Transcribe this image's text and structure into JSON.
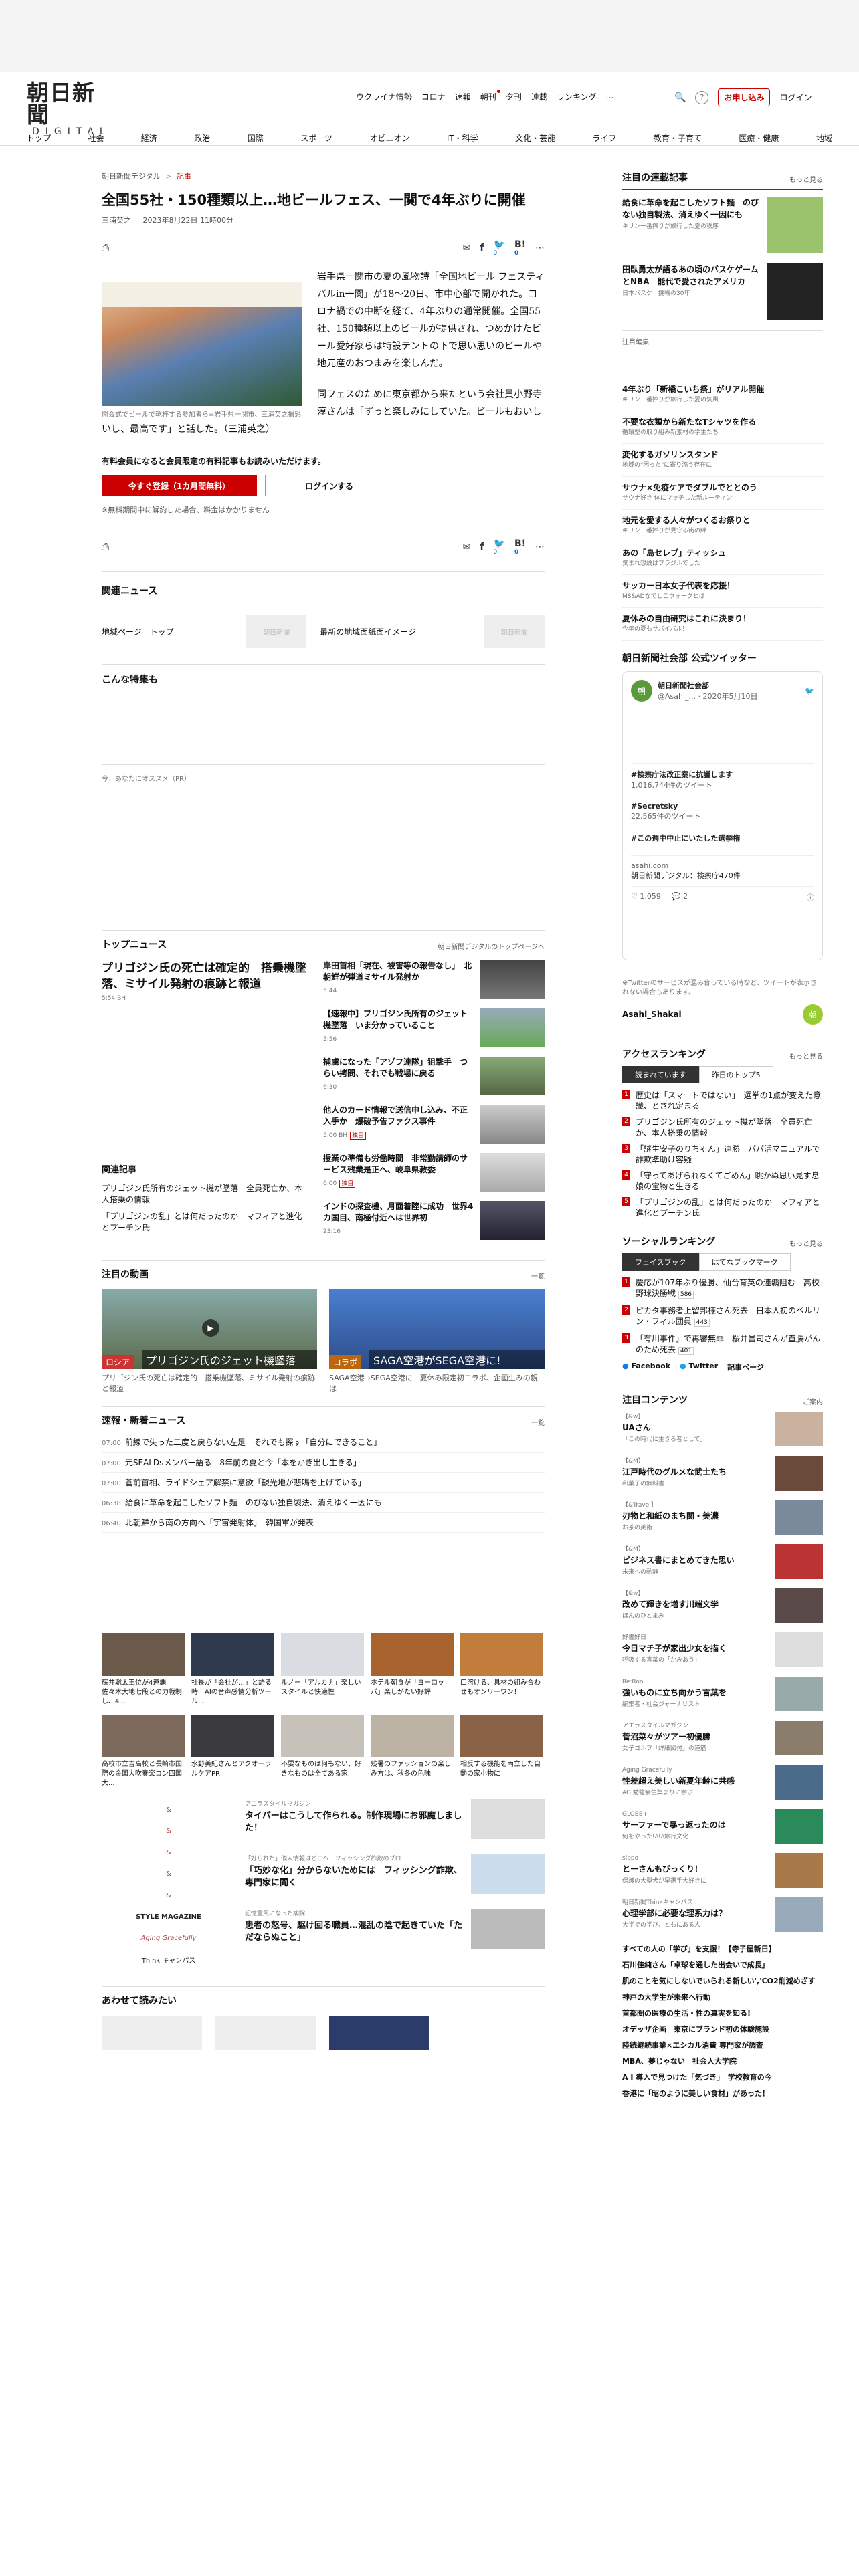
{
  "header": {
    "logo_jp": "朝日新聞",
    "logo_en": "DIGITAL",
    "gnav": [
      "ウクライナ情勢",
      "コロナ",
      "速報",
      "朝刊",
      "夕刊",
      "連載",
      "ランキング",
      "…"
    ],
    "subscribe": "お申し込み",
    "login": "ログイン",
    "categories": [
      "トップ",
      "社会",
      "経済",
      "政治",
      "国際",
      "スポーツ",
      "オピニオン",
      "IT・科学",
      "文化・芸能",
      "ライフ",
      "教育・子育て",
      "医療・健康",
      "地域"
    ]
  },
  "article": {
    "crumb_site": "朝日新聞デジタル",
    "crumb_sep": ">",
    "crumb_cat": "記事",
    "title": "全国55社・150種類以上…地ビールフェス、一関で4年ぶりに開催",
    "author": "三浦英之",
    "date": "2023年8月22日 11時00分",
    "share_count": "0",
    "photo_caption": "開会式でビールで乾杯する参加者ら=岩手県一関市、三浦英之撮影",
    "p1": "岩手県一関市の夏の風物詩「全国地ビール フェスティバルin一関」が18〜20日、市中心部で開かれた。コロナ禍での中断を経て、4年ぶりの通常開催。全国55社、150種類以上のビールが提供され、つめかけたビール愛好家らは特設テントの下で思い思いのビールや地元産のおつまみを楽しんだ。",
    "p2": "同フェスのために東京都から来たという会社員小野寺淳さんは「ずっと楽しみにしていた。ビールもおいしいし、最高です」と話した。（三浦英之）",
    "paid_note": "有料会員になると会員限定の有料記事もお読みいただけます。",
    "register_btn": "今すぐ登録（1カ月間無料）",
    "login_btn": "ログインする",
    "cancel_note": "※無料期間中に解約した場合、料金はかかりません"
  },
  "related": {
    "title": "関連ニュース",
    "item1": "地域ページ　トップ",
    "item2": "最新の地域面紙面イメージ",
    "ph": "朝日新聞"
  },
  "special": {
    "title": "こんな特集も"
  },
  "recommend": {
    "title": "今、あなたにオススメ（PR）"
  },
  "topnews": {
    "title": "トップニュース",
    "more": "朝日新聞デジタルのトップページへ",
    "lead": "プリゴジン氏の死亡は確定的　搭乗機墜落、ミサイル発射の痕跡と報道",
    "lead_time": "5:54 BH",
    "related_title": "関連記事",
    "related": [
      "プリゴジン氏所有のジェット機が墜落　全員死亡か、本人搭乗の情報",
      "「プリゴジンの乱」とは何だったのか　マフィアと進化とプーチン氏"
    ],
    "items": [
      {
        "title": "岸田首相「現在、被害等の報告なし」　北朝鮮が弾道ミサイル発射か",
        "time": "5:44"
      },
      {
        "title": "【速報中】プリゴジン氏所有のジェット機墜落　いま分かっていること",
        "time": "5:56"
      },
      {
        "title": "捕虜になった「アゾフ連隊」狙撃手　つらい拷問、それでも戦場に戻る",
        "time": "6:30"
      },
      {
        "title": "他人のカード情報で送信申し込み、不正入手か　爆破予告ファクス事件",
        "time": "5:00 BH",
        "excl": "独自"
      },
      {
        "title": "授業の準備も労働時間　非常勤講師のサービス残業是正へ、岐阜県教委",
        "time": "6:00",
        "excl": "独自"
      },
      {
        "title": "インドの探査機、月面着陸に成功　世界4カ国目、南極付近へは世界初",
        "time": "23:16"
      }
    ]
  },
  "videos": {
    "title": "注目の動画",
    "more": "一覧",
    "v1": {
      "tag": "ロシア",
      "overlay": "プリゴジン氏のジェット機墜落",
      "title": "プリゴジン氏の死亡は確定的　搭乗機墜落、ミサイル発射の痕跡と報道"
    },
    "v2": {
      "tag": "コラボ",
      "overlay": "SAGA空港がSEGA空港に!",
      "title": "SAGA空港→SEGA空港に　夏休み限定初コラボ、企画生みの親は"
    }
  },
  "flash": {
    "title": "速報・新着ニュース",
    "more": "一覧",
    "items": [
      {
        "time": "07:00",
        "text": "前線で失った二度と戻らない左足　それでも探す「自分にできること」"
      },
      {
        "time": "07:00",
        "text": "元SEALDsメンバー語る　8年前の夏と今「本をかき出し生きる」"
      },
      {
        "time": "07:00",
        "text": "菅前首相、ライドシェア解禁に意欲「観光地が悲鳴を上げている」"
      },
      {
        "time": "06:38",
        "text": "給食に革命を起こしたソフト麺　のびない独自製法、消えゆく一因にも"
      },
      {
        "time": "06:40",
        "text": "北朝鮮から南の方向へ「宇宙発射体」　韓国軍が発表"
      }
    ]
  },
  "grid": [
    "藤井聡太王位が4連覇　佐々木大地七段との力戦制し、4...",
    "社長が「会社が…」と語る時　AIの音声感情分析ツール…",
    "ルノー「アルカナ」楽しいスタイルと快適性",
    "ホテル朝食が「ヨーロッパ」楽しがたい好評",
    "口溶ける、具材の組み合わせもオンリーワン！",
    "高校市立吉高校と長崎市国際の金国大吹奏楽コン四国大...",
    "水野美紀さんとアクオーラルケアPR",
    "不要なものは何もない、好きなものは全てある家",
    "残暑のファッションの楽しみ方は、秋冬の色味",
    "相反する機能を両立した自動の家小物に"
  ],
  "ad_list": [
    {
      "kicker": "アエラスタイルマガジン",
      "title": "タイパーはこうして作られる。制作現場にお邪魔しました！"
    },
    {
      "kicker": "「好られた」個人情報はどこへ　フィッシング詐欺のプロ",
      "title": "「巧妙な化」分からないためには　フィッシング詐欺、専門家に聞く"
    },
    {
      "kicker": "記憶重風になった病院",
      "title": "患者の怒号、駆け回る職員…混乱の陰で起きていた「ただならぬこと」"
    }
  ],
  "brand_names": [
    "STYLE MAGAZINE",
    "Aging Gracefully",
    "Think キャンパス"
  ],
  "bottom": {
    "title": "あわせて読みたい"
  },
  "side": {
    "rensai_title": "注目の連載記事",
    "rensai_more": "もっと見る",
    "rensai": [
      {
        "title": "給食に革命を起こしたソフト麺　のびない独自製法、消えゆく一因にも",
        "sub": "キリン一番搾りが旅行した夏の秩序"
      },
      {
        "title": "田臥勇太が語るあの頃のバスケゲームとNBA　能代で愛されたアメリカ",
        "sub": "日本バスケ　挑戦の30年"
      }
    ],
    "feature_label": "注目編集",
    "feature": [
      {
        "title": "4年ぶり「新橋こいち祭」がリアル開催",
        "sub": "キリン一番搾りが旅行した夏の気風"
      },
      {
        "title": "不要な衣類から新たなTシャツを作る",
        "sub": "循環型の取り組み新素材の学生たち"
      },
      {
        "title": "変化するガソリンスタンド",
        "sub": "地域の\"困った\"に寄り添う存在に"
      },
      {
        "title": "サウナ×免疫ケアでダブルでととのう",
        "sub": "サウナ好き 体にマッチした新ルーティン"
      },
      {
        "title": "地元を愛する人々がつくるお祭りと",
        "sub": "キリン一番搾りが見守る街の絆"
      },
      {
        "title": "あの「島セレブ」ティッシュ",
        "sub": "気まれ想論はブラジルでした"
      },
      {
        "title": "サッカー日本女子代表を応援！",
        "sub": "MS&ADなでしこウォークとは"
      },
      {
        "title": "夏休みの自由研究はこれに決まり！",
        "sub": "今年の夏もサバイバル！"
      }
    ],
    "twitter_title": "朝日新聞社会部 公式ツイッター",
    "tw": {
      "name": "朝日新聞社会部",
      "handle": "@Asahi_...",
      "date": "2020年5月10日",
      "t1": "#検察庁法改正案に抗議します",
      "t1s": "1,016,744件のツイート",
      "t2": "#Secretsky",
      "t2s": "22,565件のツイート",
      "t3": "#この週中中止にいたした選挙権",
      "domain": "asahi.com",
      "d2": "朝日新聞デジタル：検察庁470件",
      "likes": "1,059",
      "rt": "2"
    },
    "tw_note": "※Twitterのサービスが混み合っている時など、ツイートが表示されない場合もあります。",
    "tw_account": "Asahi_Shakai",
    "ranking_title": "アクセスランキング",
    "ranking_more": "もっと見る",
    "rank_tabs": [
      "読まれています",
      "昨日のトップ5"
    ],
    "ranking": [
      "歴史は「スマートではない」　選挙の1点が変えた意識、とされ定まる",
      "プリゴジン氏所有のジェット機が墜落　全員死亡か、本人搭乗の情報",
      "「謎生安子のりちゃん」連勝　パパ活マニュアルで詐欺準助け容疑",
      "「守ってあげられなくてごめん」眺かぬ思い見す息　娘の宝物と生きる",
      "「プリゴジンの乱」とは何だったのか　マフィアと進化とプーチン氏"
    ],
    "social_title": "ソーシャルランキング",
    "social_more": "もっと見る",
    "social_tabs": [
      "フェイスブック",
      "はてなブックマーク"
    ],
    "social": [
      {
        "text": "慶応が107年ぶり優勝、仙台育英の連覇阻む　高校野球決勝戦",
        "c": "586"
      },
      {
        "text": "ピカタ事務者上留邦様さん死去　日本人初のベルリン・フィル団員",
        "c": "443"
      },
      {
        "text": "「有川事件」で再審無罪　桜井昌司さんが直腸がんのため死去",
        "c": "401"
      }
    ],
    "social_links": [
      "Facebook",
      "Twitter",
      "記事ページ"
    ],
    "content_title": "注目コンテンツ",
    "content_more": "ご案内",
    "contents": [
      {
        "k": "【&w】",
        "t": "UAさん",
        "s": "「この時代に生きる者として」"
      },
      {
        "k": "【&M】",
        "t": "江戸時代のグルメな武士たち",
        "s": "和菓子の無料書"
      },
      {
        "k": "【&Travel】",
        "t": "刃物と和紙のまち関・美濃",
        "s": "お茶の美術"
      },
      {
        "k": "【&M】",
        "t": "ビジネス書にまとめてきた思い",
        "s": "未来への動静"
      },
      {
        "k": "【&w】",
        "t": "改めて輝きを増す川端文学",
        "s": "ほんのひとまみ"
      },
      {
        "k": "好書好日",
        "t": "今日マチ子が家出少女を描く",
        "s": "呼吸する言葉の「かみあう」"
      },
      {
        "k": "Re:Ron",
        "t": "強いものに立ち向かう言葉を",
        "s": "編集者・社会ジャーナリスト"
      },
      {
        "k": "アエラスタイルマガジン",
        "t": "菅沼菜々がツアー初優勝",
        "s": "女子ゴルフ「詳細図付」の道筋"
      },
      {
        "k": "Aging Gracefully",
        "t": "性差超え美しい新夏年齢に共感",
        "s": "AG 勉強会生集まりに学ぶ"
      },
      {
        "k": "GLOBE+",
        "t": "サーファーで暴っ返ったのは",
        "s": "何をやったいい旅行文化"
      },
      {
        "k": "sippo",
        "t": "とーさんもびっくり！",
        "s": "保護の大型犬が早選手大好きに"
      },
      {
        "k": "朝日新聞Thinkキャンパス",
        "t": "心理学部に必要な理系力は？",
        "s": "大学での学び、ともにある人"
      }
    ],
    "links": [
      "すべての人の「学び」を支援！【寺子屋新日】",
      "石川佳純さん「卓球を通した出会いで成長」",
      "肌のことを気にしないでいられる新しい','CO2削減めざす　神戸の大学生が未来へ行動",
      "首都圏の医療の生活・性の真実を知る!",
      "オデッザ企画　東京にブランド初の体験施設",
      "陸続継続事業×エシカル消費 専門家が調査",
      "MBA、夢じゃない　社会人大学院",
      "A I 導入で見つけた「気づき」　学校教育の今",
      "香港に「昭のように美しい食材」があった！"
    ]
  }
}
